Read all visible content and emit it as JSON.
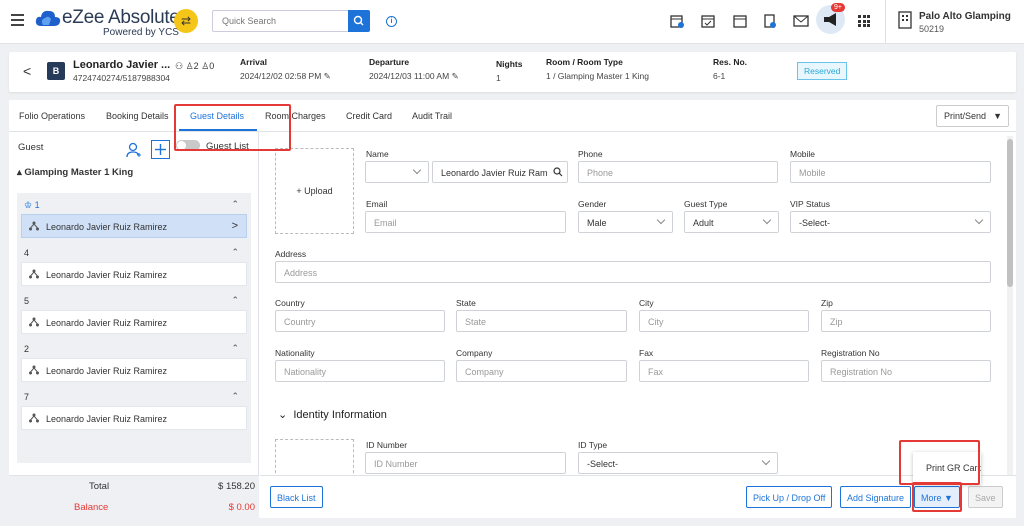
{
  "header": {
    "brand": "eZee Absolute",
    "powered": "Powered by YCS",
    "search_placeholder": "Quick Search",
    "announcement_badge": "9+",
    "hotel_name": "Palo Alto Glamping",
    "hotel_id": "50219"
  },
  "reservation": {
    "guest_name": "Leonardo Javier ...",
    "guest_phone": "4724740274/5187988304",
    "badge": "B",
    "adults": "2",
    "children": "0",
    "arrival_label": "Arrival",
    "arrival_value": "2024/12/02 02:58 PM",
    "departure_label": "Departure",
    "departure_value": "2024/12/03 11:00 AM",
    "nights_label": "Nights",
    "nights_value": "1",
    "room_label": "Room / Room Type",
    "room_value": "1 / Glamping Master 1 King",
    "resno_label": "Res. No.",
    "resno_value": "6-1",
    "status": "Reserved"
  },
  "tabs": [
    "Folio Operations",
    "Booking Details",
    "Guest Details",
    "Room Charges",
    "Credit Card",
    "Audit Trail"
  ],
  "print_send": "Print/Send",
  "left": {
    "guest_label": "Guest",
    "guest_list_label": "Guest List",
    "room_type": "Glamping Master 1 King",
    "sections": [
      {
        "no": "1",
        "guest": "Leonardo Javier Ruiz Ramirez"
      },
      {
        "no": "4",
        "guest": "Leonardo Javier Ruiz Ramirez"
      },
      {
        "no": "5",
        "guest": "Leonardo Javier Ruiz Ramirez"
      },
      {
        "no": "2",
        "guest": "Leonardo Javier Ruiz Ramirez"
      },
      {
        "no": "7",
        "guest": "Leonardo Javier Ruiz Ramirez"
      }
    ],
    "total_label": "Total",
    "total_value": "$ 158.20",
    "balance_label": "Balance",
    "balance_value": "$ 0.00"
  },
  "form": {
    "upload": "+ Upload",
    "name_label": "Name",
    "name_value": "Leonardo Javier Ruiz Ram",
    "phone_label": "Phone",
    "phone_ph": "Phone",
    "mobile_label": "Mobile",
    "mobile_ph": "Mobile",
    "email_label": "Email",
    "email_ph": "Email",
    "gender_label": "Gender",
    "gender_value": "Male",
    "guest_type_label": "Guest Type",
    "guest_type_value": "Adult",
    "vip_label": "VIP Status",
    "vip_value": "-Select-",
    "address_label": "Address",
    "address_ph": "Address",
    "country_label": "Country",
    "country_ph": "Country",
    "state_label": "State",
    "state_ph": "State",
    "city_label": "City",
    "city_ph": "City",
    "zip_label": "Zip",
    "zip_ph": "Zip",
    "nationality_label": "Nationality",
    "nationality_ph": "Nationality",
    "company_label": "Company",
    "company_ph": "Company",
    "fax_label": "Fax",
    "fax_ph": "Fax",
    "reg_label": "Registration No",
    "reg_ph": "Registration No",
    "identity_heading": "Identity Information",
    "id_number_label": "ID Number",
    "id_number_ph": "ID Number",
    "id_type_label": "ID Type",
    "id_type_value": "-Select-"
  },
  "footer": {
    "black_list": "Black List",
    "pickup": "Pick Up / Drop Off",
    "signature": "Add Signature",
    "more": "More",
    "save": "Save",
    "popup": "Print GR Card"
  }
}
